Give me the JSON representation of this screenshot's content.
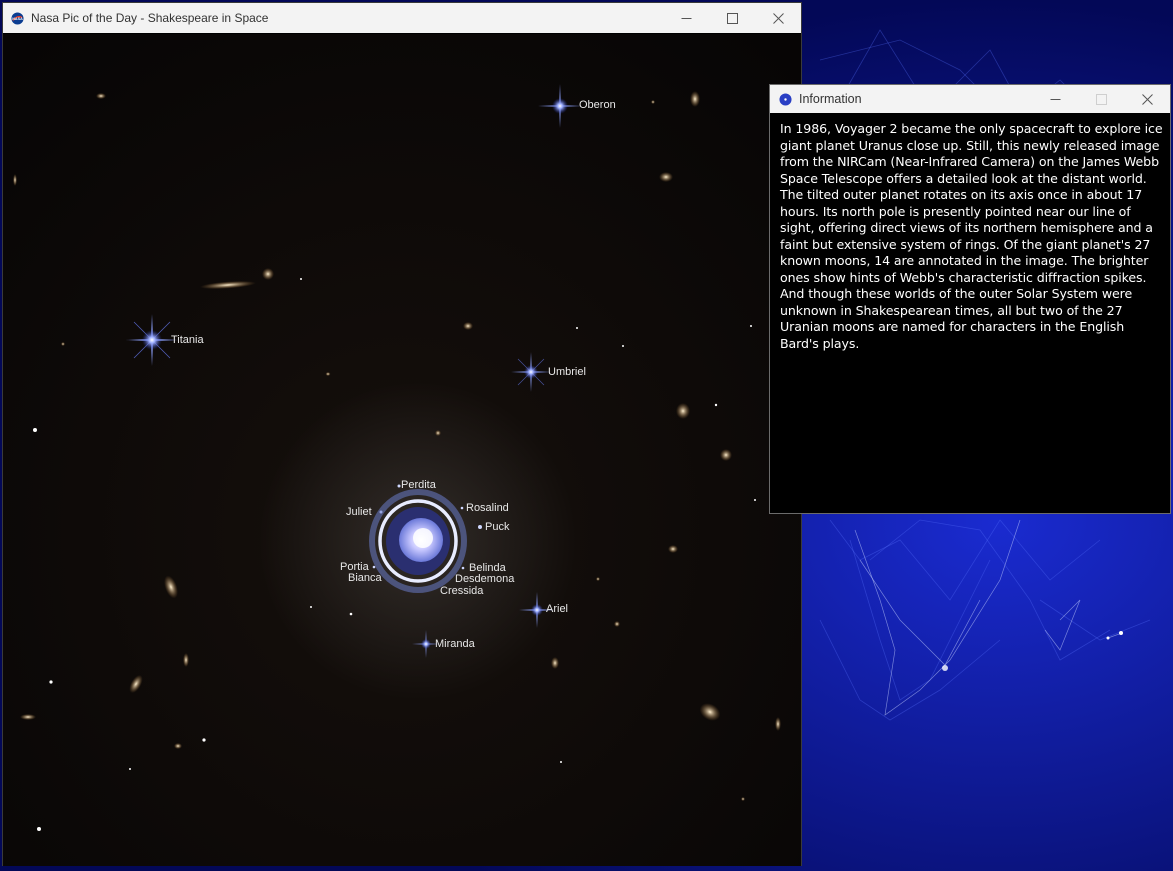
{
  "main_window": {
    "title": "Nasa Pic of the Day - Shakespeare in Space",
    "icon": "nasa-logo-icon",
    "controls": [
      "minimize-icon",
      "maximize-icon",
      "close-icon"
    ]
  },
  "image": {
    "moons": {
      "oberon": "Oberon",
      "titania": "Titania",
      "umbriel": "Umbriel",
      "perdita": "Perdita",
      "juliet": "Juliet",
      "rosalind": "Rosalind",
      "puck": "Puck",
      "portia": "Portia",
      "bianca": "Bianca",
      "belinda": "Belinda",
      "desdemona": "Desdemona",
      "cressida": "Cressida",
      "ariel": "Ariel",
      "miranda": "Miranda"
    }
  },
  "info_window": {
    "title": "Information",
    "icon": "info-dot-icon",
    "text": "In 1986, Voyager 2 became the only spacecraft to explore ice giant planet Uranus close up. Still, this newly released image from the NIRCam (Near-Infrared Camera) on the James Webb Space Telescope offers a detailed look at the distant world. The tilted outer planet rotates on its axis once in about 17 hours. Its north pole is presently pointed near our line of sight, offering direct views of its northern hemisphere and a faint but extensive system of rings. Of the giant planet's 27 known moons, 14 are annotated in the image. The brighter ones show hints of Webb's characteristic diffraction spikes. And though these worlds of the outer Solar System were unknown in Shakespearean times, all but two of the 27 Uranian moons are named for characters in the English Bard's plays."
  },
  "colors": {
    "wallpaper": "#050a6e",
    "titlebar": "#f3f3f3",
    "space": "#0b0807",
    "info_accent": "#2a3fc4"
  }
}
